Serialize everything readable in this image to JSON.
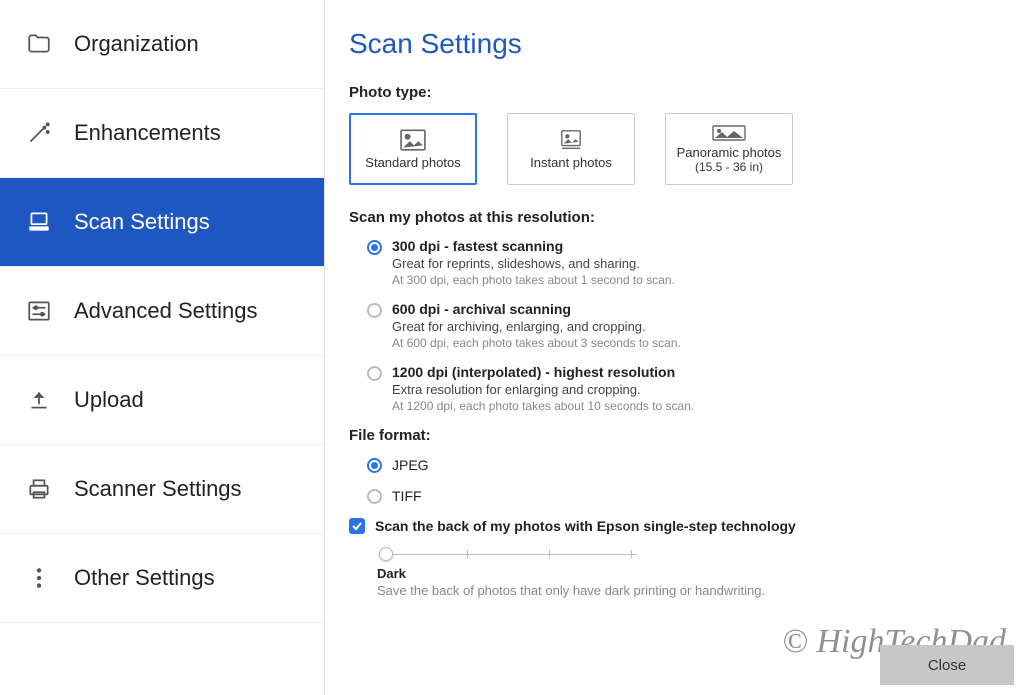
{
  "sidebar": {
    "items": [
      {
        "label": "Organization"
      },
      {
        "label": "Enhancements"
      },
      {
        "label": "Scan Settings"
      },
      {
        "label": "Advanced Settings"
      },
      {
        "label": "Upload"
      },
      {
        "label": "Scanner Settings"
      },
      {
        "label": "Other Settings"
      }
    ]
  },
  "page": {
    "title": "Scan Settings"
  },
  "photoType": {
    "label": "Photo type:",
    "options": [
      {
        "label": "Standard photos",
        "sub": ""
      },
      {
        "label": "Instant photos",
        "sub": ""
      },
      {
        "label": "Panoramic photos",
        "sub": "(15.5 - 36 in)"
      }
    ]
  },
  "resolution": {
    "label": "Scan my photos at this resolution:",
    "options": [
      {
        "title": "300 dpi - fastest scanning",
        "desc": "Great for reprints, slideshows, and sharing.",
        "note": "At 300 dpi, each photo takes about 1 second to scan."
      },
      {
        "title": "600 dpi - archival scanning",
        "desc": "Great for archiving, enlarging, and cropping.",
        "note": "At 600 dpi, each photo takes about 3 seconds to scan."
      },
      {
        "title": "1200 dpi (interpolated) - highest resolution",
        "desc": "Extra resolution for enlarging and cropping.",
        "note": "At 1200 dpi, each photo takes about 10 seconds to scan."
      }
    ]
  },
  "fileFormat": {
    "label": "File format:",
    "options": [
      {
        "label": "JPEG"
      },
      {
        "label": "TIFF"
      }
    ]
  },
  "scanBack": {
    "label": "Scan the back of my photos with Epson single-step technology",
    "sliderLabel": "Dark",
    "sliderDesc": "Save the back of photos that only have dark printing or handwriting."
  },
  "footer": {
    "close": "Close"
  },
  "watermark": "© HighTechDad"
}
